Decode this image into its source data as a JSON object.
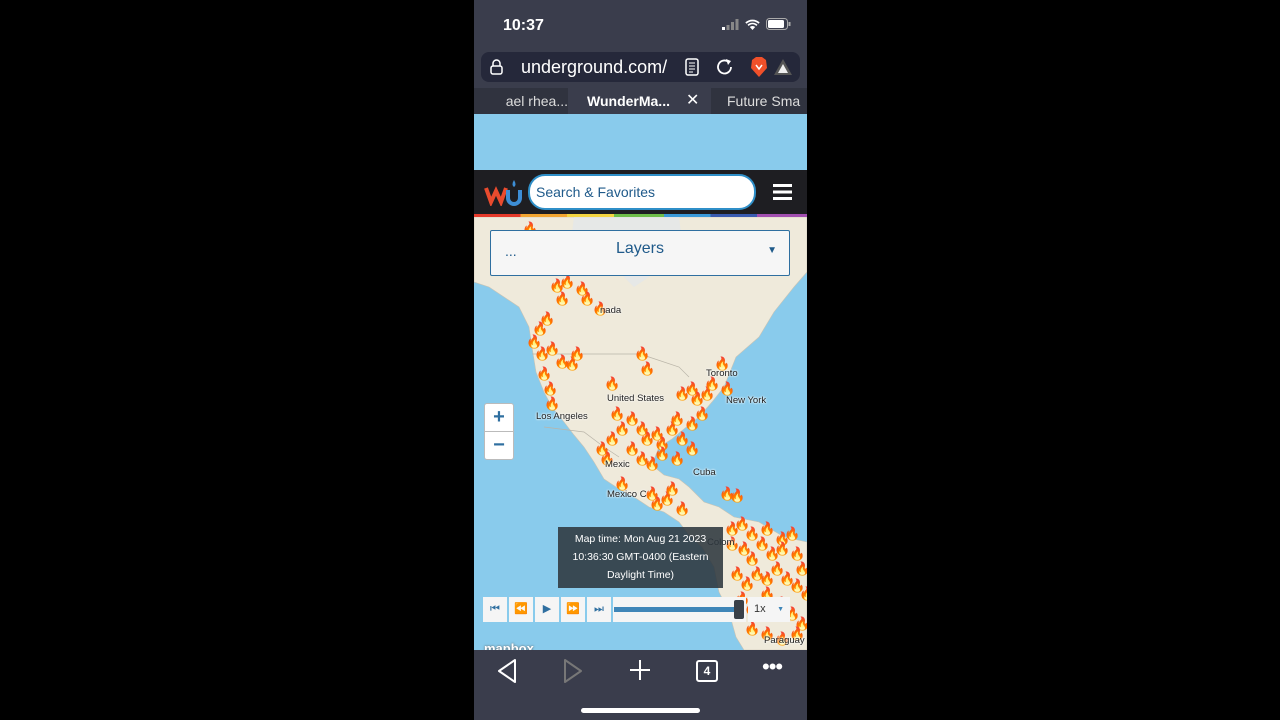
{
  "status": {
    "time": "10:37",
    "signal": "cellular-signal-icon",
    "wifi": "wifi-icon",
    "battery": "battery-icon"
  },
  "browser": {
    "url": "underground.com/",
    "tabs": [
      {
        "label": "ael rhea..."
      },
      {
        "label": "WunderMa...",
        "active": true
      },
      {
        "label": "Future Sma"
      }
    ],
    "tab_count": "4"
  },
  "site": {
    "search_placeholder": "Search & Favorites",
    "layers_prefix": "...",
    "layers_label": "Layers",
    "brand_color": "#1e1e22",
    "accent": "#2f8fc8"
  },
  "map": {
    "labels": {
      "canada": "nada",
      "united_states": "United States",
      "toronto": "Toronto",
      "new_york": "New York",
      "los_angeles": "Los Angeles",
      "mexico": "Mexic",
      "mexico_city": "Mexico C",
      "cuba": "Cuba",
      "colombia": "Colom",
      "paraguay": "Paraguay",
      "attribution": "mapbox"
    },
    "zoom_in": "+",
    "zoom_out": "−",
    "map_time": {
      "line1": "Map time: Mon Aug 21 2023",
      "line2": "10:36:30 GMT-0400 (Eastern",
      "line3": "Daylight Time)"
    },
    "player": {
      "speed": "1x",
      "progress_percent": 100
    },
    "marker_icon": "fire-icon"
  }
}
